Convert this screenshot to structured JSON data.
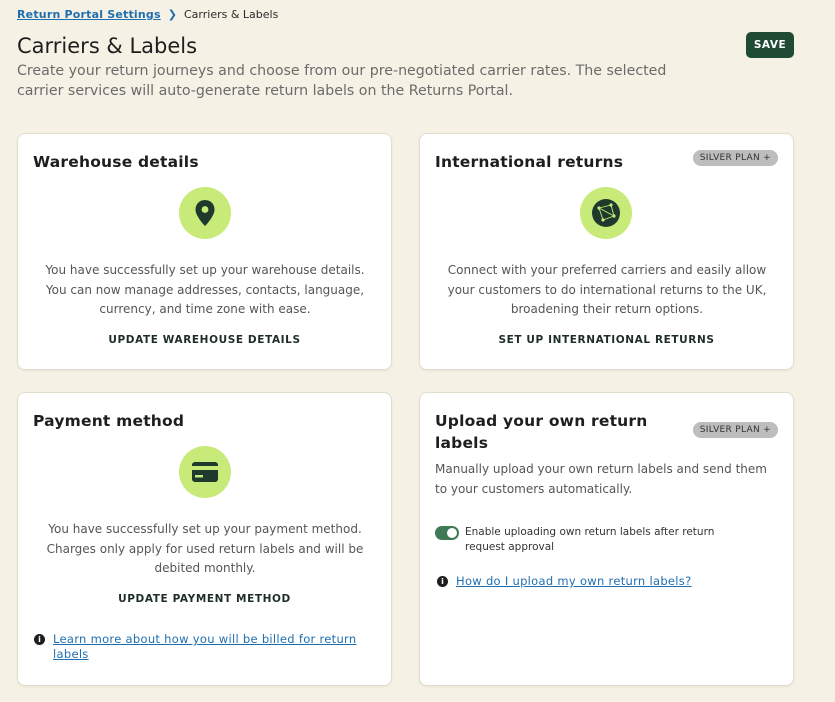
{
  "breadcrumb": {
    "parent": "Return Portal Settings",
    "current": "Carriers & Labels"
  },
  "header": {
    "title": "Carriers & Labels",
    "save_label": "SAVE",
    "subtitle": "Create your return journeys and choose from our pre-negotiated carrier rates. The selected carrier services will auto-generate return labels on the Returns Portal."
  },
  "cards": {
    "warehouse": {
      "title": "Warehouse details",
      "icon": "location-pin-icon",
      "text": "You have successfully set up your warehouse details. You can now manage addresses, contacts, language, currency, and time zone with ease.",
      "link": "UPDATE WAREHOUSE DETAILS"
    },
    "international": {
      "title": "International returns",
      "badge": "SILVER PLAN +",
      "icon": "globe-network-icon",
      "text": "Connect with your preferred carriers and easily allow your customers to do international returns to the UK, broadening their return options.",
      "link": "SET UP INTERNATIONAL RETURNS"
    },
    "payment": {
      "title": "Payment method",
      "icon": "credit-card-icon",
      "text": "You have successfully set up your payment method. Charges only apply for used return labels and will be debited monthly.",
      "link": "UPDATE PAYMENT METHOD",
      "info_link": "Learn more about how you will be billed for return labels"
    },
    "upload": {
      "title": "Upload your own return labels",
      "badge": "SILVER PLAN +",
      "text": "Manually upload your own return labels and send them to your customers automatically.",
      "toggle_label": "Enable uploading own return labels after return request approval",
      "toggle_on": true,
      "info_link": "How do I upload my own return labels?"
    }
  },
  "colors": {
    "accent": "#1f4a33",
    "icon_bg": "#c7ea78",
    "link": "#1f6fb0",
    "page_bg": "#f6f1e5"
  }
}
